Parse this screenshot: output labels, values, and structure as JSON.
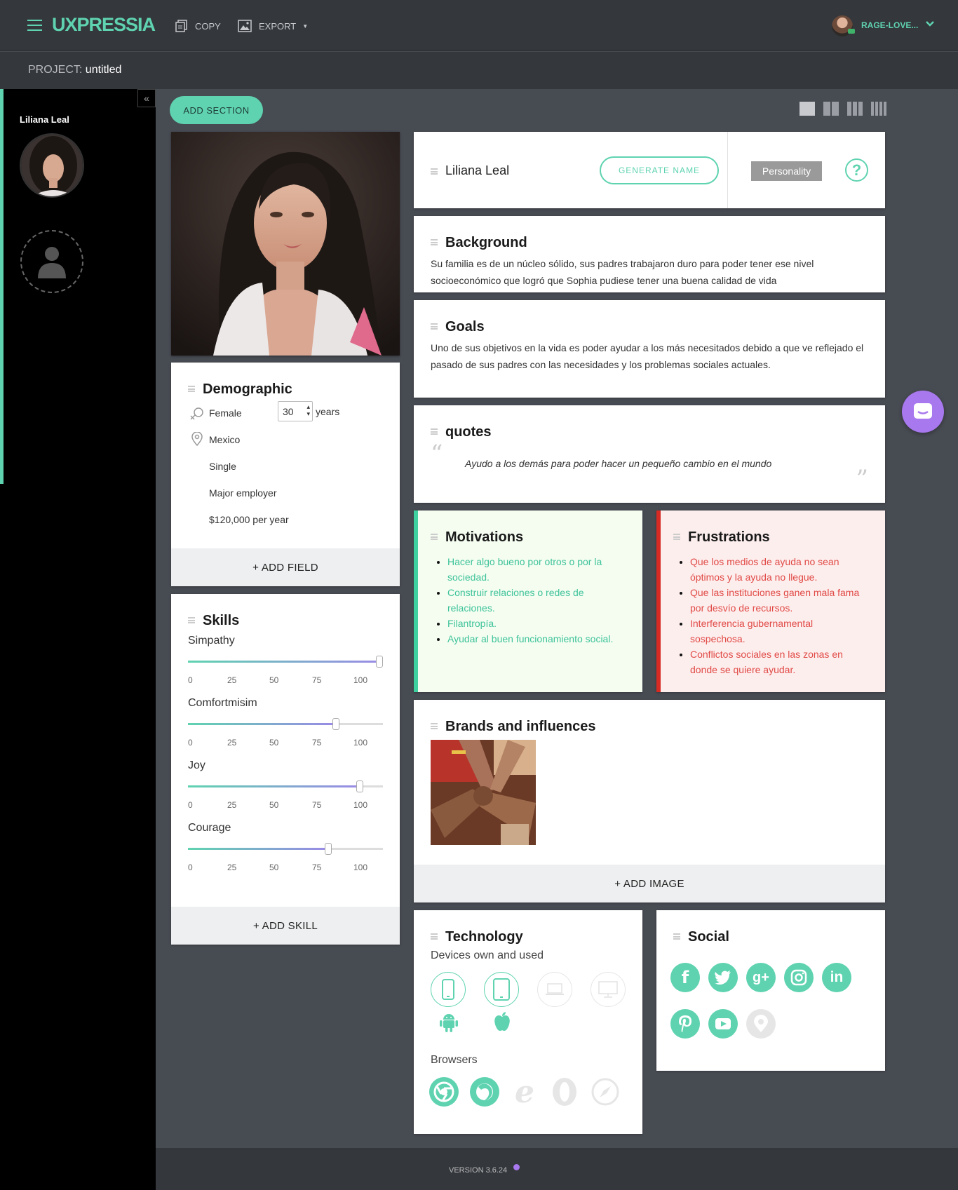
{
  "app": {
    "logo": "UXPRESSIA",
    "copy_label": "COPY",
    "export_label": "EXPORT",
    "user_name": "RAGE-LOVE...",
    "project_prefix": "PROJECT:",
    "project_name": "untitled",
    "version": "VERSION 3.6.24",
    "accent_color": "#5fd3b0"
  },
  "sidebar": {
    "persona_name": "Liliana Leal",
    "collapse_icon": "«"
  },
  "toolbar": {
    "add_section": "ADD SECTION"
  },
  "header_card": {
    "persona_name": "Liliana Leal",
    "generate_label": "GENERATE NAME",
    "personality_label": "Personality",
    "help_label": "?"
  },
  "background": {
    "title": "Background",
    "text": "Su familia es de un núcleo sólido, sus padres trabajaron duro para poder tener ese nivel socioeconómico que logró que Sophia pudiese tener una buena calidad de vida"
  },
  "goals": {
    "title": "Goals",
    "text": "Uno de sus objetivos en la vida es poder ayudar a los más necesitados debido a que ve reflejado el pasado de sus padres con las necesidades y los problemas sociales actuales."
  },
  "quotes": {
    "title": "quotes",
    "open_mark": "“",
    "close_mark": "”",
    "text": "Ayudo a los demás para poder hacer un pequeño cambio en el mundo"
  },
  "demographic": {
    "title": "Demographic",
    "gender": "Female",
    "age": "30",
    "age_unit": "years",
    "location": "Mexico",
    "status": "Single",
    "occupation": "Major employer",
    "income": "$120,000 per year",
    "add_field": "+ ADD FIELD"
  },
  "skills": {
    "title": "Skills",
    "ticks": [
      "0",
      "25",
      "50",
      "75",
      "100"
    ],
    "items": [
      {
        "label": "Simpathy",
        "value": 100
      },
      {
        "label": "Comfortmisim",
        "value": 76
      },
      {
        "label": "Joy",
        "value": 88
      },
      {
        "label": "Courage",
        "value": 72
      }
    ],
    "add_skill": "+ ADD SKILL"
  },
  "motivations": {
    "title": "Motivations",
    "items": [
      "Hacer algo bueno por otros o por la sociedad.",
      "Construir relaciones o redes de relaciones.",
      "Filantropía.",
      "Ayudar al buen funcionamiento social."
    ]
  },
  "frustrations": {
    "title": "Frustrations",
    "items": [
      "Que los medios de ayuda no sean óptimos y la ayuda no llegue.",
      "Que las instituciones ganen mala fama por desvío de recursos.",
      "Interferencia gubernamental sospechosa.",
      "Conflictos sociales en las zonas en donde se quiere ayudar."
    ]
  },
  "brands": {
    "title": "Brands and influences",
    "add_image": "+ ADD IMAGE"
  },
  "technology": {
    "title": "Technology",
    "devices_label": "Devices own and used",
    "browsers_label": "Browsers",
    "devices": [
      {
        "icon": "smartphone-icon",
        "active": true
      },
      {
        "icon": "tablet-icon",
        "active": true
      },
      {
        "icon": "laptop-icon",
        "active": false
      },
      {
        "icon": "desktop-icon",
        "active": false
      }
    ],
    "os": [
      {
        "icon": "android-icon"
      },
      {
        "icon": "apple-icon"
      }
    ],
    "browsers": [
      {
        "icon": "chrome-icon",
        "active": true
      },
      {
        "icon": "firefox-icon",
        "active": true
      },
      {
        "icon": "ie-icon",
        "active": false
      },
      {
        "icon": "opera-icon",
        "active": false
      },
      {
        "icon": "safari-icon",
        "active": false
      }
    ]
  },
  "social": {
    "title": "Social",
    "glyphs": {
      "facebook": "f",
      "googleplus": "g+",
      "linkedin": "in"
    },
    "networks": [
      {
        "icon": "facebook-icon",
        "active": true
      },
      {
        "icon": "twitter-icon",
        "active": true
      },
      {
        "icon": "google-plus-icon",
        "active": true
      },
      {
        "icon": "instagram-icon",
        "active": true
      },
      {
        "icon": "linkedin-icon",
        "active": true
      },
      {
        "icon": "pinterest-icon",
        "active": true
      },
      {
        "icon": "youtube-icon",
        "active": true
      },
      {
        "icon": "periscope-icon",
        "active": false
      }
    ]
  }
}
